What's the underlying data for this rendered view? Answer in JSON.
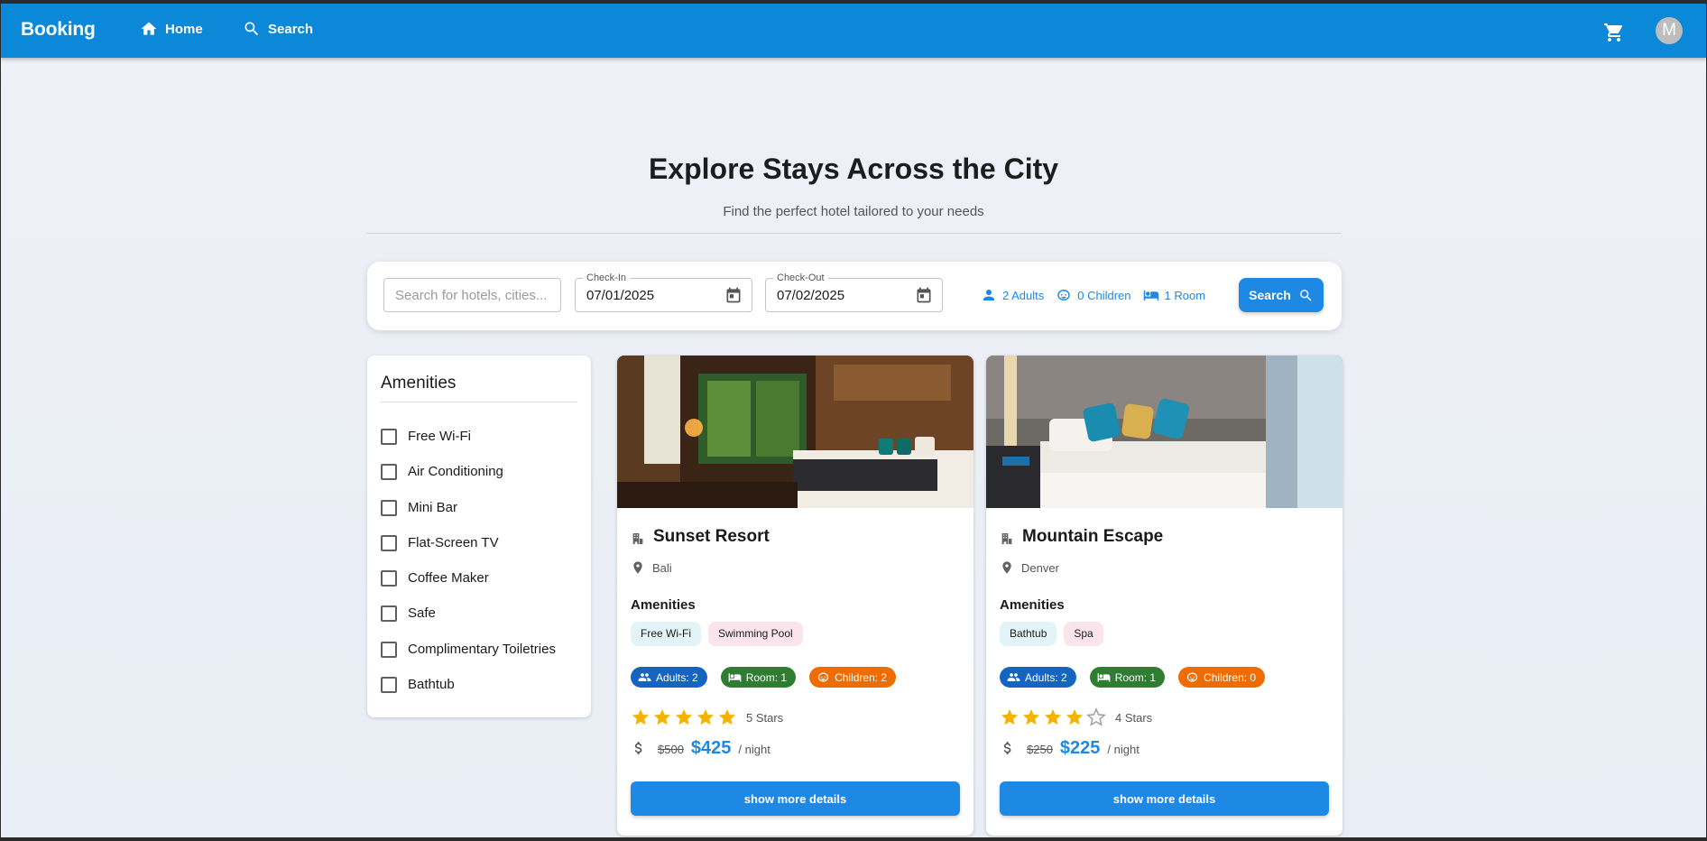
{
  "appbar": {
    "brand": "Booking",
    "nav": [
      {
        "label": "Home",
        "icon": "home-icon"
      },
      {
        "label": "Search",
        "icon": "search-icon"
      }
    ],
    "cart_icon": "cart-icon",
    "avatar_initial": "M"
  },
  "hero": {
    "title": "Explore Stays Across the City",
    "subtitle": "Find the perfect hotel tailored to your needs"
  },
  "search": {
    "placeholder": "Search for hotels, cities...",
    "checkin_label": "Check-In",
    "checkin_value": "07/01/2025",
    "checkout_label": "Check-Out",
    "checkout_value": "07/02/2025",
    "adults": "2 Adults",
    "children": "0 Children",
    "rooms": "1 Room",
    "button": "Search"
  },
  "filters": {
    "title": "Amenities",
    "items": [
      "Free Wi-Fi",
      "Air Conditioning",
      "Mini Bar",
      "Flat-Screen TV",
      "Coffee Maker",
      "Safe",
      "Complimentary Toiletries",
      "Bathtub"
    ]
  },
  "hotels": [
    {
      "name": "Sunset Resort",
      "location": "Bali",
      "amenities_heading": "Amenities",
      "amenities": [
        "Free Wi-Fi",
        "Swimming Pool"
      ],
      "adults": "Adults: 2",
      "room": "Room: 1",
      "children": "Children: 2",
      "stars": 5,
      "stars_text": "5 Stars",
      "old_price": "$500",
      "price": "$425",
      "per_night": "/ night",
      "button": "show more details"
    },
    {
      "name": "Mountain Escape",
      "location": "Denver",
      "amenities_heading": "Amenities",
      "amenities": [
        "Bathtub",
        "Spa"
      ],
      "adults": "Adults: 2",
      "room": "Room: 1",
      "children": "Children: 0",
      "stars": 4,
      "stars_text": "4 Stars",
      "old_price": "$250",
      "price": "$225",
      "per_night": "/ night",
      "button": "show more details"
    }
  ],
  "colors": {
    "primary": "#0b88d8",
    "button": "#1e88e5",
    "star": "#f5b301",
    "adults_badge": "#1565c0",
    "room_badge": "#2e7d32",
    "children_badge": "#ef6c00"
  }
}
